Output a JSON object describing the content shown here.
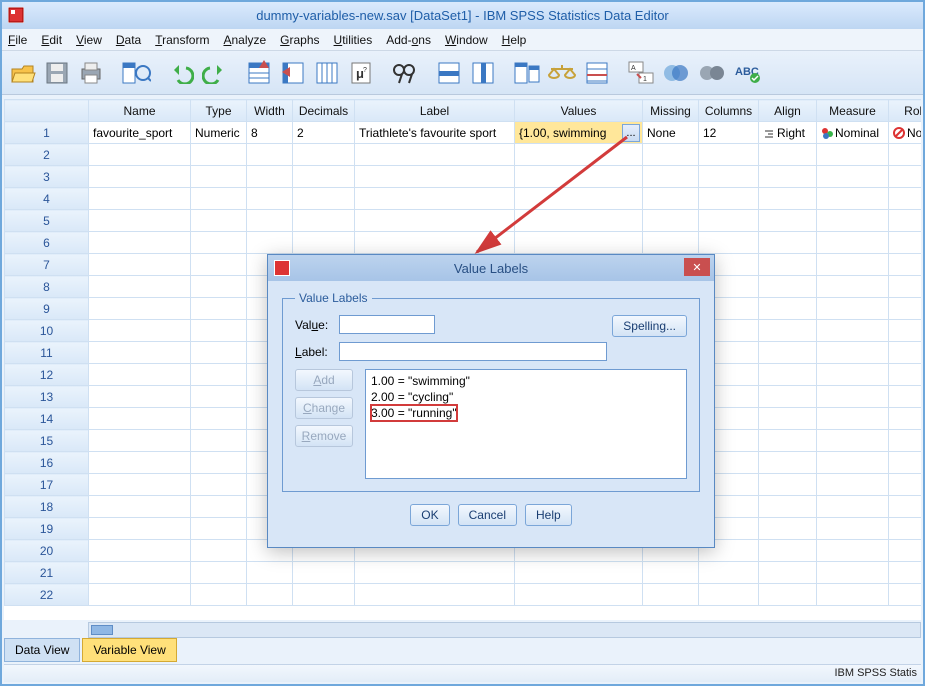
{
  "window": {
    "title": "dummy-variables-new.sav [DataSet1] - IBM SPSS Statistics Data Editor"
  },
  "menu": {
    "file": "File",
    "edit": "Edit",
    "view": "View",
    "data": "Data",
    "transform": "Transform",
    "analyze": "Analyze",
    "graphs": "Graphs",
    "utilities": "Utilities",
    "addons": "Add-ons",
    "window": "Window",
    "help": "Help"
  },
  "columns": {
    "name": "Name",
    "type": "Type",
    "width": "Width",
    "decimals": "Decimals",
    "label": "Label",
    "values": "Values",
    "missing": "Missing",
    "columns": "Columns",
    "align": "Align",
    "measure": "Measure",
    "role": "Role"
  },
  "row1": {
    "num": "1",
    "name": "favourite_sport",
    "type": "Numeric",
    "width": "8",
    "decimals": "2",
    "label": "Triathlete's favourite sport",
    "values": "{1.00, swimming",
    "missing": "None",
    "columns": "12",
    "align": "Right",
    "measure": "Nominal",
    "role": "None"
  },
  "rownums": [
    "2",
    "3",
    "4",
    "5",
    "6",
    "7",
    "8",
    "9",
    "10",
    "11",
    "12",
    "13",
    "14",
    "15",
    "16",
    "17",
    "18",
    "19",
    "20",
    "21",
    "22"
  ],
  "tabs": {
    "data": "Data View",
    "variable": "Variable View"
  },
  "status": "IBM SPSS Statis",
  "dialog": {
    "title": "Value Labels",
    "legend": "Value Labels",
    "value_label": "Value:",
    "label_label": "Label:",
    "spelling": "Spelling...",
    "add": "Add",
    "change": "Change",
    "remove": "Remove",
    "items": [
      {
        "text": "1.00 = \"swimming\"",
        "hl": false
      },
      {
        "text": "2.00 = \"cycling\"",
        "hl": false
      },
      {
        "text": "3.00 = \"running\"",
        "hl": true
      }
    ],
    "ok": "OK",
    "cancel": "Cancel",
    "help": "Help"
  },
  "ellipsis": "..."
}
